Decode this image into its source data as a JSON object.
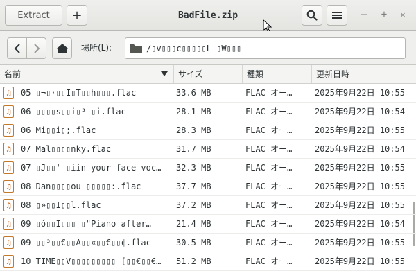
{
  "header": {
    "extract_label": "Extract",
    "add_label": "+",
    "title": "BadFile.zip",
    "minimize": "–",
    "maximize": "+",
    "close": "✕"
  },
  "toolbar": {
    "location_label": "場所(L):",
    "location_path": "/▯v▯▯▯c▯▯▯▯▯L ▯W▯▯▯"
  },
  "columns": {
    "name": "名前",
    "size": "サイズ",
    "type": "種類",
    "modified": "更新日時"
  },
  "files": [
    {
      "name": "05 ▯¬▯·▯▯I▯T▯▯h▯▯▯.flac",
      "size": "33.6 MB",
      "type": "FLAC オー…",
      "modified": "2025年9月22日 10:55"
    },
    {
      "name": "06 ▯▯▯▯s▯▯i▯³ ▯i.flac",
      "size": "28.1 MB",
      "type": "FLAC オー…",
      "modified": "2025年9月22日 10:54"
    },
    {
      "name": "06 Mi▯▯i▯;.flac",
      "size": "28.3 MB",
      "type": "FLAC オー…",
      "modified": "2025年9月22日 10:55"
    },
    {
      "name": "07 Mal▯▯▯▯nky.flac",
      "size": "31.7 MB",
      "type": "FLAC オー…",
      "modified": "2025年9月22日 10:54"
    },
    {
      "name": "07 ▯J▯▯' ▯iin your face voc…",
      "size": "32.3 MB",
      "type": "FLAC オー…",
      "modified": "2025年9月22日 10:55"
    },
    {
      "name": "08 Dan▯▯▯▯ou ▯▯▯▯▯:.flac",
      "size": "37.7 MB",
      "type": "FLAC オー…",
      "modified": "2025年9月22日 10:55"
    },
    {
      "name": "08 ▯»▯▯I▯▯l.flac",
      "size": "37.2 MB",
      "type": "FLAC オー…",
      "modified": "2025年9月22日 10:55"
    },
    {
      "name": "09 ▯ó▯▯I▯▯▯ ▯\"Piano after…",
      "size": "21.4 MB",
      "type": "FLAC オー…",
      "modified": "2025年9月22日 10:54"
    },
    {
      "name": "09 ▯▯³▯▯€▯▯À▯▯«▯▯€▯▯¢.flac",
      "size": "30.5 MB",
      "type": "FLAC オー…",
      "modified": "2025年9月22日 10:55"
    },
    {
      "name": "10 TIME▯▯V▯▯▯▯▯▯▯▯▯ [▯▯€▯▯€…",
      "size": "51.2 MB",
      "type": "FLAC オー…",
      "modified": "2025年9月22日 10:55"
    }
  ]
}
